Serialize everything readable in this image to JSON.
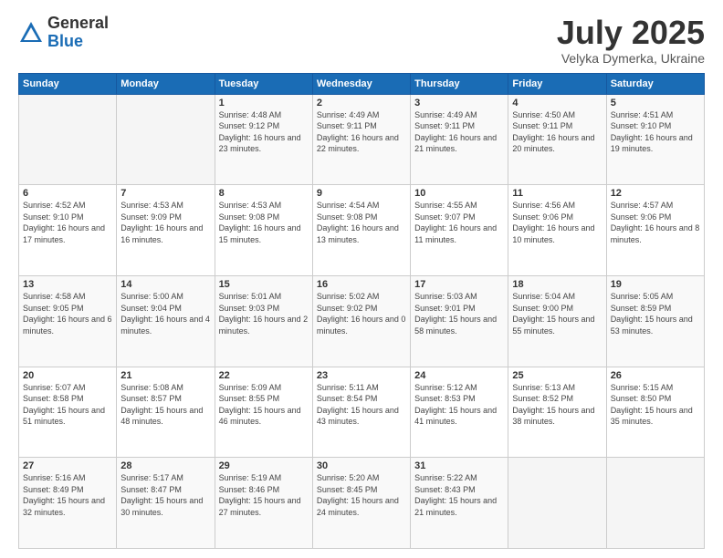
{
  "logo": {
    "general": "General",
    "blue": "Blue"
  },
  "header": {
    "title": "July 2025",
    "subtitle": "Velyka Dymerka, Ukraine"
  },
  "calendar": {
    "days": [
      "Sunday",
      "Monday",
      "Tuesday",
      "Wednesday",
      "Thursday",
      "Friday",
      "Saturday"
    ]
  },
  "weeks": [
    [
      null,
      null,
      {
        "day": 1,
        "sunrise": "Sunrise: 4:48 AM",
        "sunset": "Sunset: 9:12 PM",
        "daylight": "Daylight: 16 hours and 23 minutes."
      },
      {
        "day": 2,
        "sunrise": "Sunrise: 4:49 AM",
        "sunset": "Sunset: 9:11 PM",
        "daylight": "Daylight: 16 hours and 22 minutes."
      },
      {
        "day": 3,
        "sunrise": "Sunrise: 4:49 AM",
        "sunset": "Sunset: 9:11 PM",
        "daylight": "Daylight: 16 hours and 21 minutes."
      },
      {
        "day": 4,
        "sunrise": "Sunrise: 4:50 AM",
        "sunset": "Sunset: 9:11 PM",
        "daylight": "Daylight: 16 hours and 20 minutes."
      },
      {
        "day": 5,
        "sunrise": "Sunrise: 4:51 AM",
        "sunset": "Sunset: 9:10 PM",
        "daylight": "Daylight: 16 hours and 19 minutes."
      }
    ],
    [
      {
        "day": 6,
        "sunrise": "Sunrise: 4:52 AM",
        "sunset": "Sunset: 9:10 PM",
        "daylight": "Daylight: 16 hours and 17 minutes."
      },
      {
        "day": 7,
        "sunrise": "Sunrise: 4:53 AM",
        "sunset": "Sunset: 9:09 PM",
        "daylight": "Daylight: 16 hours and 16 minutes."
      },
      {
        "day": 8,
        "sunrise": "Sunrise: 4:53 AM",
        "sunset": "Sunset: 9:08 PM",
        "daylight": "Daylight: 16 hours and 15 minutes."
      },
      {
        "day": 9,
        "sunrise": "Sunrise: 4:54 AM",
        "sunset": "Sunset: 9:08 PM",
        "daylight": "Daylight: 16 hours and 13 minutes."
      },
      {
        "day": 10,
        "sunrise": "Sunrise: 4:55 AM",
        "sunset": "Sunset: 9:07 PM",
        "daylight": "Daylight: 16 hours and 11 minutes."
      },
      {
        "day": 11,
        "sunrise": "Sunrise: 4:56 AM",
        "sunset": "Sunset: 9:06 PM",
        "daylight": "Daylight: 16 hours and 10 minutes."
      },
      {
        "day": 12,
        "sunrise": "Sunrise: 4:57 AM",
        "sunset": "Sunset: 9:06 PM",
        "daylight": "Daylight: 16 hours and 8 minutes."
      }
    ],
    [
      {
        "day": 13,
        "sunrise": "Sunrise: 4:58 AM",
        "sunset": "Sunset: 9:05 PM",
        "daylight": "Daylight: 16 hours and 6 minutes."
      },
      {
        "day": 14,
        "sunrise": "Sunrise: 5:00 AM",
        "sunset": "Sunset: 9:04 PM",
        "daylight": "Daylight: 16 hours and 4 minutes."
      },
      {
        "day": 15,
        "sunrise": "Sunrise: 5:01 AM",
        "sunset": "Sunset: 9:03 PM",
        "daylight": "Daylight: 16 hours and 2 minutes."
      },
      {
        "day": 16,
        "sunrise": "Sunrise: 5:02 AM",
        "sunset": "Sunset: 9:02 PM",
        "daylight": "Daylight: 16 hours and 0 minutes."
      },
      {
        "day": 17,
        "sunrise": "Sunrise: 5:03 AM",
        "sunset": "Sunset: 9:01 PM",
        "daylight": "Daylight: 15 hours and 58 minutes."
      },
      {
        "day": 18,
        "sunrise": "Sunrise: 5:04 AM",
        "sunset": "Sunset: 9:00 PM",
        "daylight": "Daylight: 15 hours and 55 minutes."
      },
      {
        "day": 19,
        "sunrise": "Sunrise: 5:05 AM",
        "sunset": "Sunset: 8:59 PM",
        "daylight": "Daylight: 15 hours and 53 minutes."
      }
    ],
    [
      {
        "day": 20,
        "sunrise": "Sunrise: 5:07 AM",
        "sunset": "Sunset: 8:58 PM",
        "daylight": "Daylight: 15 hours and 51 minutes."
      },
      {
        "day": 21,
        "sunrise": "Sunrise: 5:08 AM",
        "sunset": "Sunset: 8:57 PM",
        "daylight": "Daylight: 15 hours and 48 minutes."
      },
      {
        "day": 22,
        "sunrise": "Sunrise: 5:09 AM",
        "sunset": "Sunset: 8:55 PM",
        "daylight": "Daylight: 15 hours and 46 minutes."
      },
      {
        "day": 23,
        "sunrise": "Sunrise: 5:11 AM",
        "sunset": "Sunset: 8:54 PM",
        "daylight": "Daylight: 15 hours and 43 minutes."
      },
      {
        "day": 24,
        "sunrise": "Sunrise: 5:12 AM",
        "sunset": "Sunset: 8:53 PM",
        "daylight": "Daylight: 15 hours and 41 minutes."
      },
      {
        "day": 25,
        "sunrise": "Sunrise: 5:13 AM",
        "sunset": "Sunset: 8:52 PM",
        "daylight": "Daylight: 15 hours and 38 minutes."
      },
      {
        "day": 26,
        "sunrise": "Sunrise: 5:15 AM",
        "sunset": "Sunset: 8:50 PM",
        "daylight": "Daylight: 15 hours and 35 minutes."
      }
    ],
    [
      {
        "day": 27,
        "sunrise": "Sunrise: 5:16 AM",
        "sunset": "Sunset: 8:49 PM",
        "daylight": "Daylight: 15 hours and 32 minutes."
      },
      {
        "day": 28,
        "sunrise": "Sunrise: 5:17 AM",
        "sunset": "Sunset: 8:47 PM",
        "daylight": "Daylight: 15 hours and 30 minutes."
      },
      {
        "day": 29,
        "sunrise": "Sunrise: 5:19 AM",
        "sunset": "Sunset: 8:46 PM",
        "daylight": "Daylight: 15 hours and 27 minutes."
      },
      {
        "day": 30,
        "sunrise": "Sunrise: 5:20 AM",
        "sunset": "Sunset: 8:45 PM",
        "daylight": "Daylight: 15 hours and 24 minutes."
      },
      {
        "day": 31,
        "sunrise": "Sunrise: 5:22 AM",
        "sunset": "Sunset: 8:43 PM",
        "daylight": "Daylight: 15 hours and 21 minutes."
      },
      null,
      null
    ]
  ]
}
